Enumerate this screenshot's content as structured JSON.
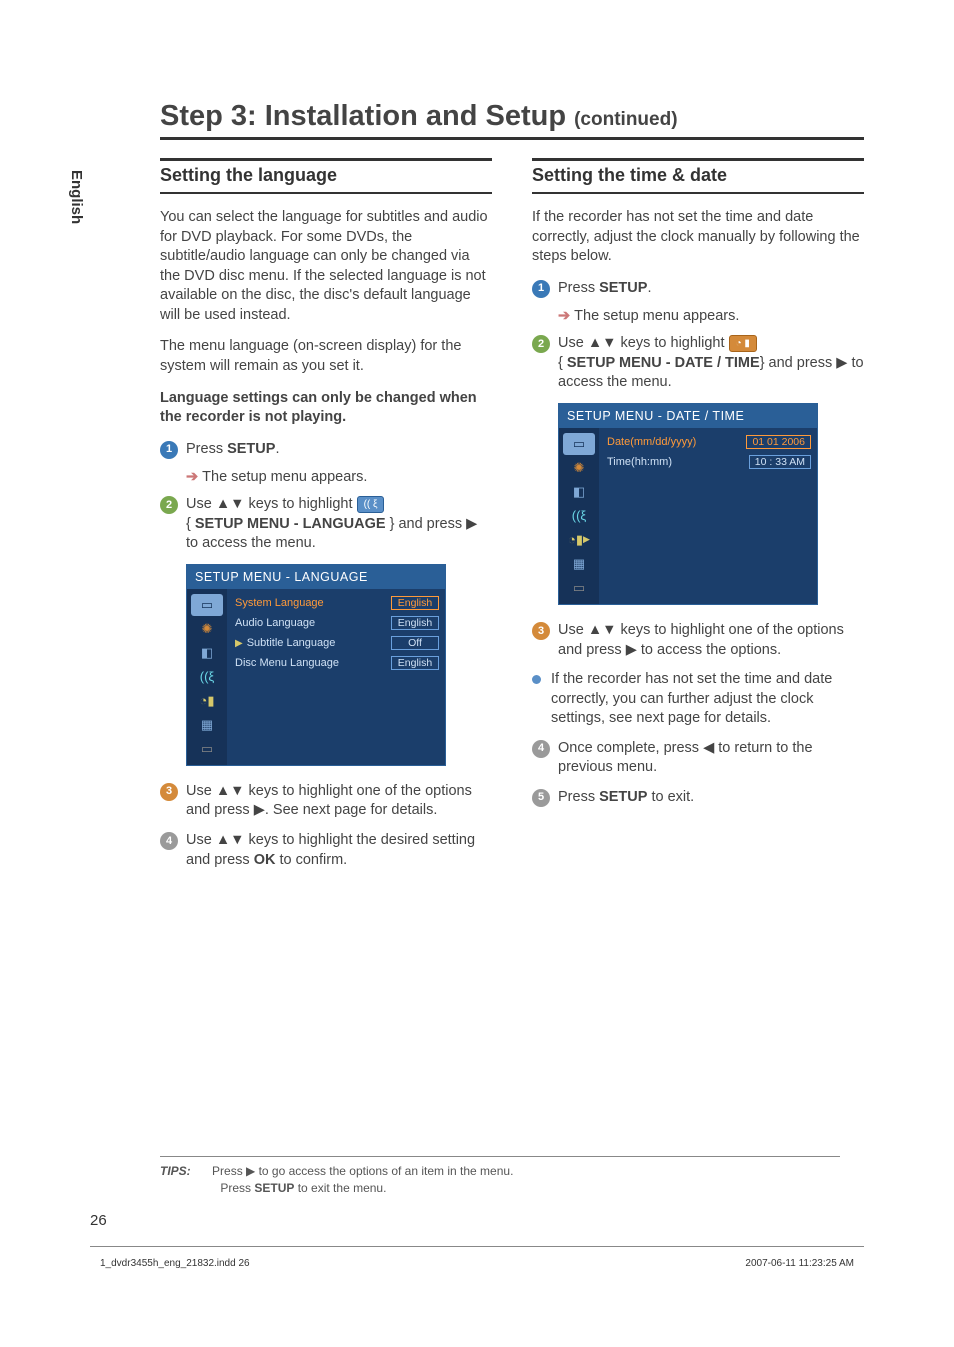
{
  "page": {
    "title": "Step 3: Installation and Setup",
    "continued": "(continued)",
    "lang_tab": "English",
    "page_number": "26"
  },
  "left": {
    "heading": "Setting the language",
    "p1": "You can select the language for subtitles and audio for DVD playback. For some DVDs, the subtitle/audio language can only be changed via the DVD disc menu. If the selected language is not available on the disc, the disc's default language will be used instead.",
    "p2": "The menu language (on-screen display) for the system will remain as you set it.",
    "p3_bold": "Language settings can only be changed when the recorder is not playing.",
    "s1_a": "Press ",
    "s1_b": "SETUP",
    "s1_c": ".",
    "s1_sub": "The setup menu appears.",
    "s2_a": "Use ▲▼ keys to highlight ",
    "s2_b": "{ ",
    "s2_c": "SETUP MENU - LANGUAGE",
    "s2_d": " } and press ▶ to access the menu.",
    "s3": "Use ▲▼ keys to highlight one of the options and press ▶. See next page for details.",
    "s4_a": "Use ▲▼ keys to highlight the desired setting and press ",
    "s4_b": "OK",
    "s4_c": " to confirm."
  },
  "menu_lang": {
    "title": "SETUP MENU - LANGUAGE",
    "rows": [
      {
        "label": "System Language",
        "val": "English",
        "active": true
      },
      {
        "label": "Audio Language",
        "val": "English",
        "active": false
      },
      {
        "label": "Subtitle Language",
        "val": "Off",
        "active": false,
        "play": true
      },
      {
        "label": "Disc Menu Language",
        "val": "English",
        "active": false
      }
    ]
  },
  "right": {
    "heading": "Setting the time & date",
    "p1": "If the recorder has not set the time and date correctly, adjust the clock manually by following the steps below.",
    "s1_a": "Press ",
    "s1_b": "SETUP",
    "s1_c": ".",
    "s1_sub": "The setup menu appears.",
    "s2_a": "Use ▲▼ keys to highlight ",
    "s2_b": "{ ",
    "s2_c": "SETUP MENU - DATE / TIME",
    "s2_d": "} and press ▶ to access the menu.",
    "s3": "Use ▲▼ keys to highlight one of the options and press ▶ to access the options.",
    "bullet": "If the recorder has not set the time and date correctly, you can further adjust the clock settings, see next page for details.",
    "s4": "Once complete, press ◀ to return to the previous menu.",
    "s5_a": "Press ",
    "s5_b": "SETUP",
    "s5_c": " to exit."
  },
  "menu_dt": {
    "title": "SETUP MENU - DATE / TIME",
    "rows": [
      {
        "label": "Date(mm/dd/yyyy)",
        "val": "01  01  2006",
        "active": true
      },
      {
        "label": "Time(hh:mm)",
        "val": "10 : 33  AM",
        "active": false
      }
    ]
  },
  "tips": {
    "label": "TIPS:",
    "l1_a": "Press ▶ to go access the options of an item in the menu.",
    "l2_a": "Press ",
    "l2_b": "SETUP",
    "l2_c": " to exit the menu."
  },
  "footer": {
    "left": "1_dvdr3455h_eng_21832.indd   26",
    "right": "2007-06-11   11:23:25 AM"
  }
}
